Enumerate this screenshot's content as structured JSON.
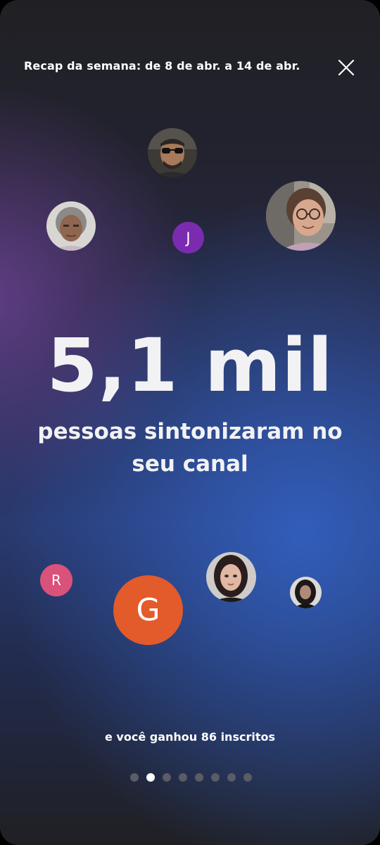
{
  "header": {
    "title": "Recap da semana: de 8 de abr. a 14 de abr.",
    "close_icon": "close-icon"
  },
  "main": {
    "value": "5,1 mil",
    "description": "pessoas sintonizaram no seu canal",
    "subscribers_text": "e você ganhou 86 inscritos"
  },
  "avatars": {
    "letters": {
      "j": "J",
      "r": "R",
      "g": "G"
    },
    "colors": {
      "j": "#7a2bb0",
      "r": "#d9527a",
      "g": "#e35b2a"
    }
  },
  "pagination": {
    "total": 8,
    "current": 2
  }
}
